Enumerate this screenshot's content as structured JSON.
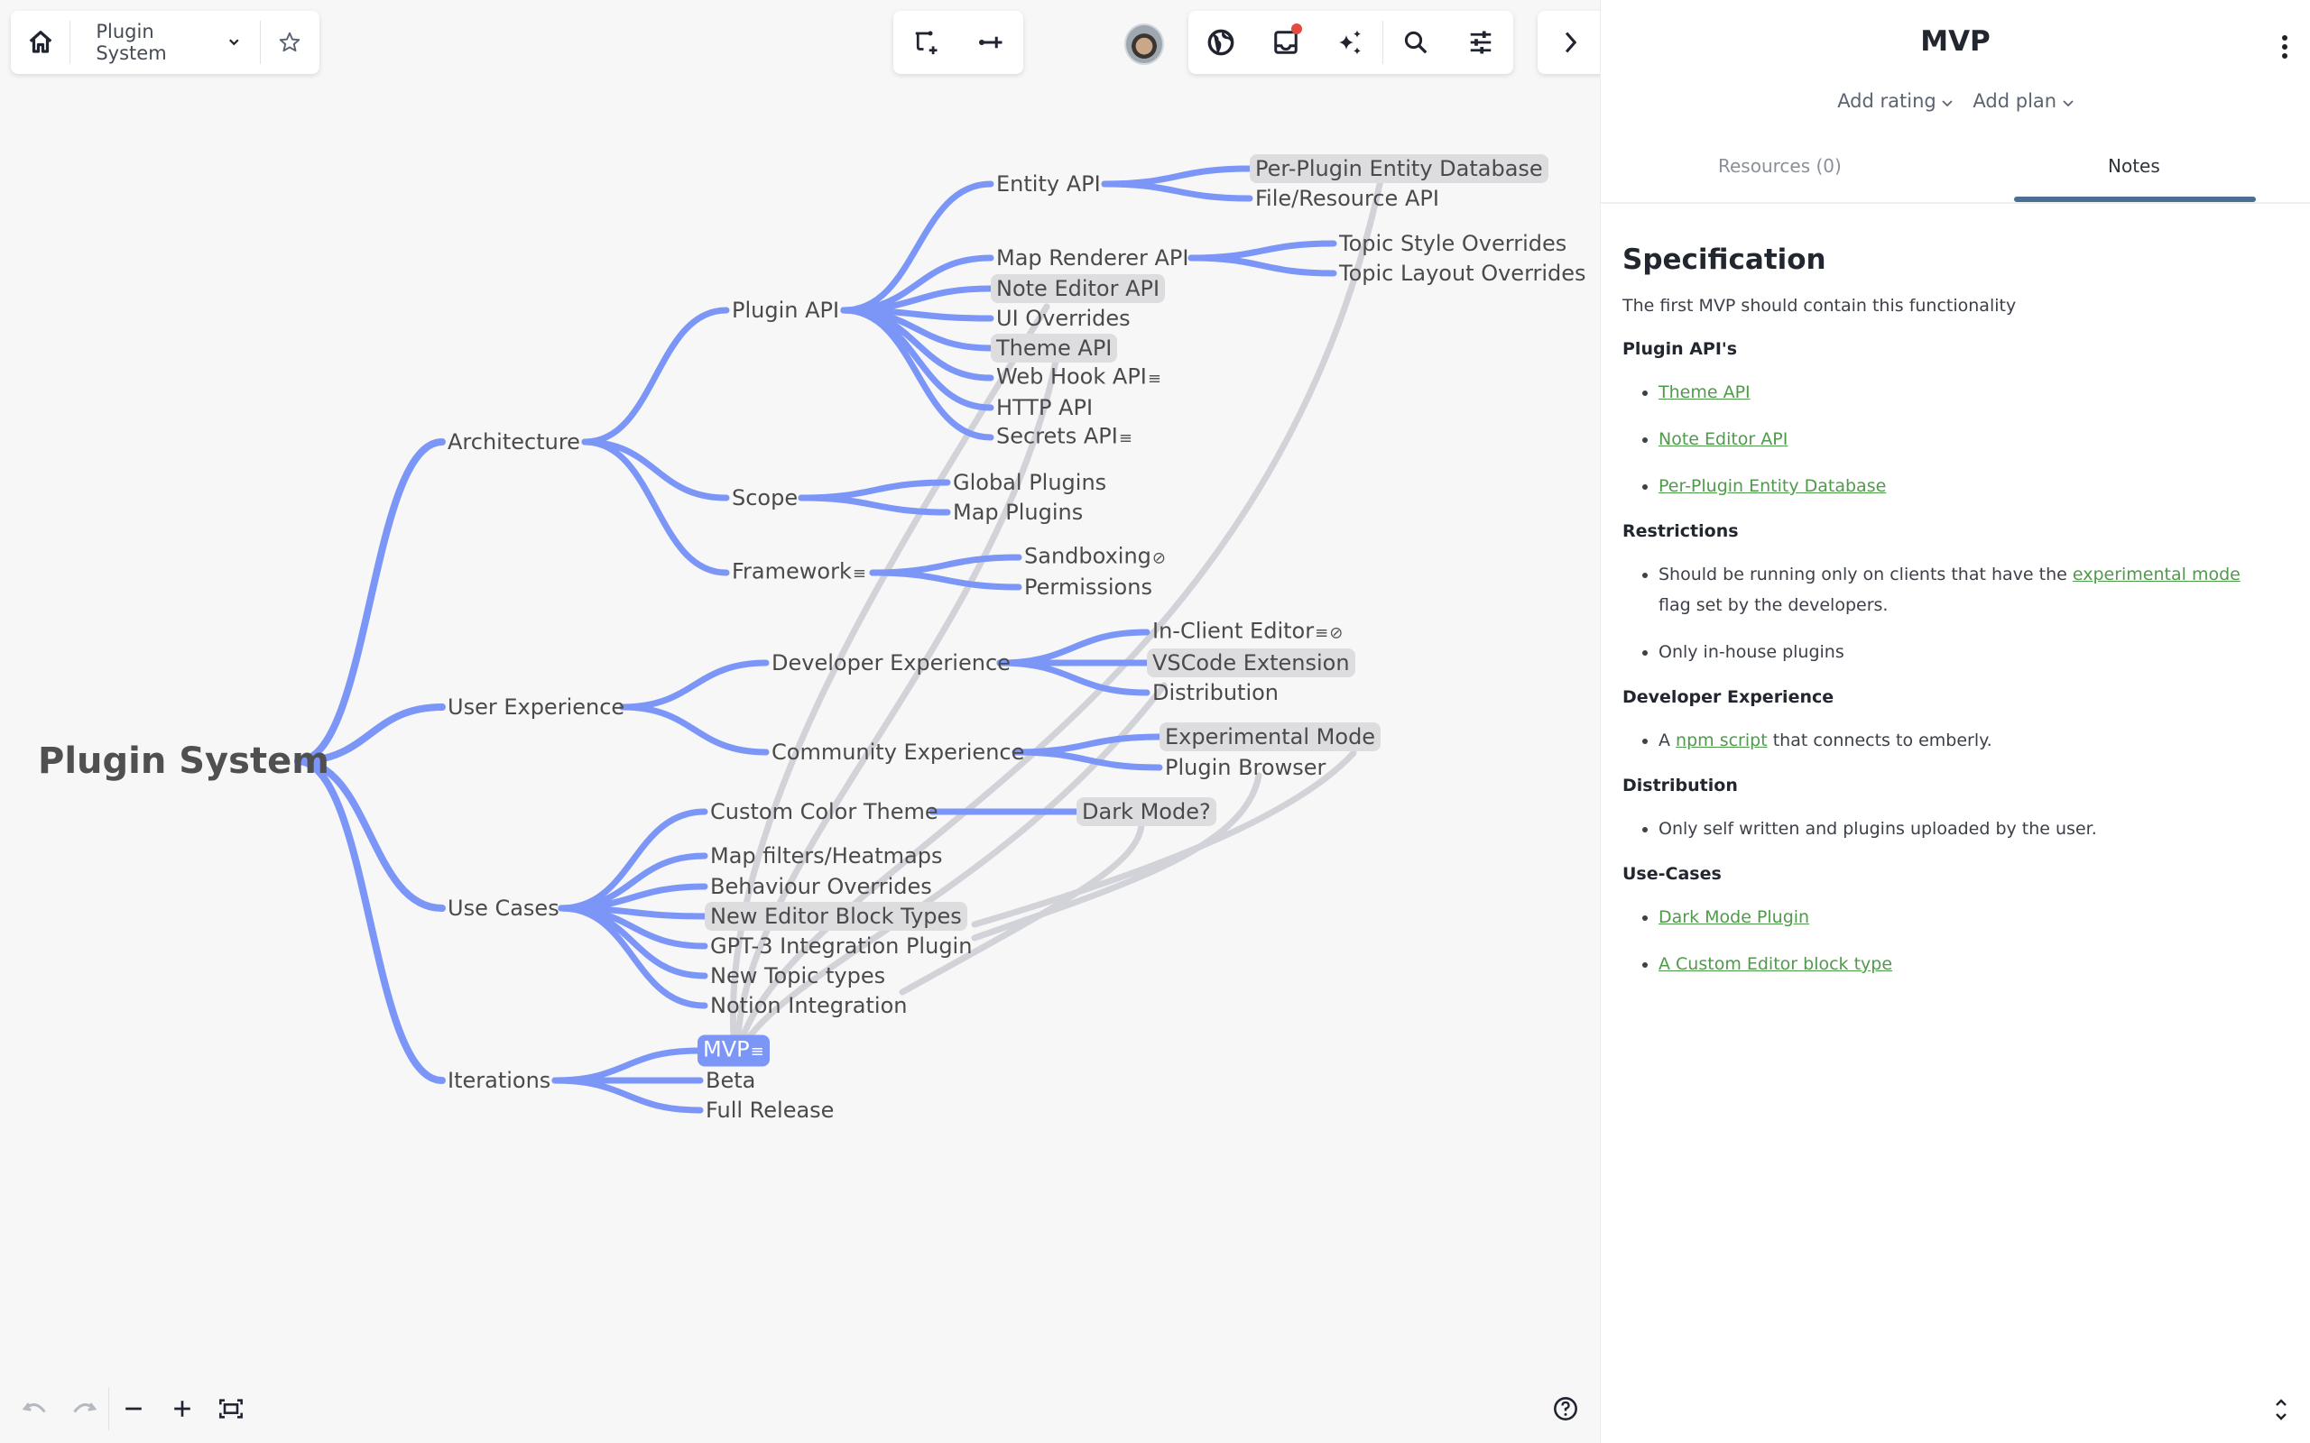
{
  "topbar": {
    "map_title": "Plugin System",
    "icons": [
      "home-icon",
      "chevron-down-icon",
      "star-icon",
      "add-child-topic-icon",
      "add-sibling-topic-icon",
      "avatar",
      "globe-icon",
      "inbox-icon",
      "sparkles-icon",
      "search-icon",
      "sliders-icon",
      "chevron-right-icon"
    ],
    "inbox_has_notification": true
  },
  "colors": {
    "branch": "#7b96f7",
    "relation": "#d2d3d8",
    "highlight": "#dddde0",
    "selected": "#7b96f7",
    "link": "#4f9a4b",
    "tab_accent": "#4a6f95"
  },
  "mindmap": {
    "root": "Plugin System",
    "nodes": {
      "architecture": "Architecture",
      "user_experience": "User Experience",
      "use_cases": "Use Cases",
      "iterations": "Iterations",
      "plugin_api": "Plugin API",
      "scope": "Scope",
      "framework": "Framework",
      "entity_api": "Entity API",
      "map_renderer_api": "Map Renderer API",
      "note_editor_api": "Note Editor API",
      "ui_overrides": "UI Overrides",
      "theme_api": "Theme API",
      "web_hook_api": "Web Hook API",
      "http_api": "HTTP API",
      "secrets_api": "Secrets API",
      "per_plugin_db": "Per-Plugin Entity Database",
      "file_resource_api": "File/Resource API",
      "topic_style": "Topic Style Overrides",
      "topic_layout": "Topic Layout Overrides",
      "global_plugins": "Global Plugins",
      "map_plugins": "Map Plugins",
      "sandboxing": "Sandboxing",
      "permissions": "Permissions",
      "developer_experience": "Developer Experience",
      "community_experience": "Community Experience",
      "in_client_editor": "In-Client Editor",
      "vscode_extension": "VSCode Extension",
      "distribution": "Distribution",
      "experimental_mode": "Experimental Mode",
      "plugin_browser": "Plugin Browser",
      "custom_color_theme": "Custom Color Theme",
      "dark_mode": "Dark Mode?",
      "map_filters": "Map filters/Heatmaps",
      "behaviour_overrides": "Behaviour Overrides",
      "new_editor_block": "New Editor Block Types",
      "gpt3": "GPT-3 Integration Plugin",
      "new_topic_types": "New Topic types",
      "notion": "Notion Integration",
      "mvp": "MVP",
      "beta": "Beta",
      "full_release": "Full Release"
    },
    "selected": "MVP",
    "highlighted": [
      "Per-Plugin Entity Database",
      "Note Editor API",
      "Theme API",
      "VSCode Extension",
      "Experimental Mode",
      "Dark Mode?",
      "New Editor Block Types"
    ],
    "note_icon": "≡",
    "attachment_icon": "⊘"
  },
  "sidebar": {
    "title": "MVP",
    "add_rating": "Add rating",
    "add_plan": "Add plan",
    "tabs": [
      {
        "label": "Resources (0)",
        "active": false
      },
      {
        "label": "Notes",
        "active": true
      }
    ],
    "notes": {
      "heading": "Specification",
      "intro": "The first MVP should contain this functionality",
      "plugin_apis_heading": "Plugin API's",
      "plugin_apis": [
        "Theme API",
        "Note Editor API",
        "Per-Plugin Entity Database"
      ],
      "restrictions_heading": "Restrictions",
      "restriction1_before": "Should be running only on clients that have the ",
      "restriction1_link": "experimental mode",
      "restriction1_after": " flag set by the developers.",
      "restriction2": "Only in-house plugins",
      "devx_heading": "Developer Experience",
      "devx_before": "A ",
      "devx_link": "npm script",
      "devx_after": " that connects to emberly.",
      "distribution_heading": "Distribution",
      "distribution_item": "Only self written and plugins uploaded by the user.",
      "usecases_heading": "Use-Cases",
      "usecases": [
        "Dark Mode Plugin",
        "A Custom Editor block type"
      ]
    }
  },
  "bottom": {
    "icons": [
      "undo-icon",
      "redo-icon",
      "zoom-out-icon",
      "zoom-in-icon",
      "fit-screen-icon",
      "help-icon",
      "expand-collapse-icon"
    ]
  }
}
